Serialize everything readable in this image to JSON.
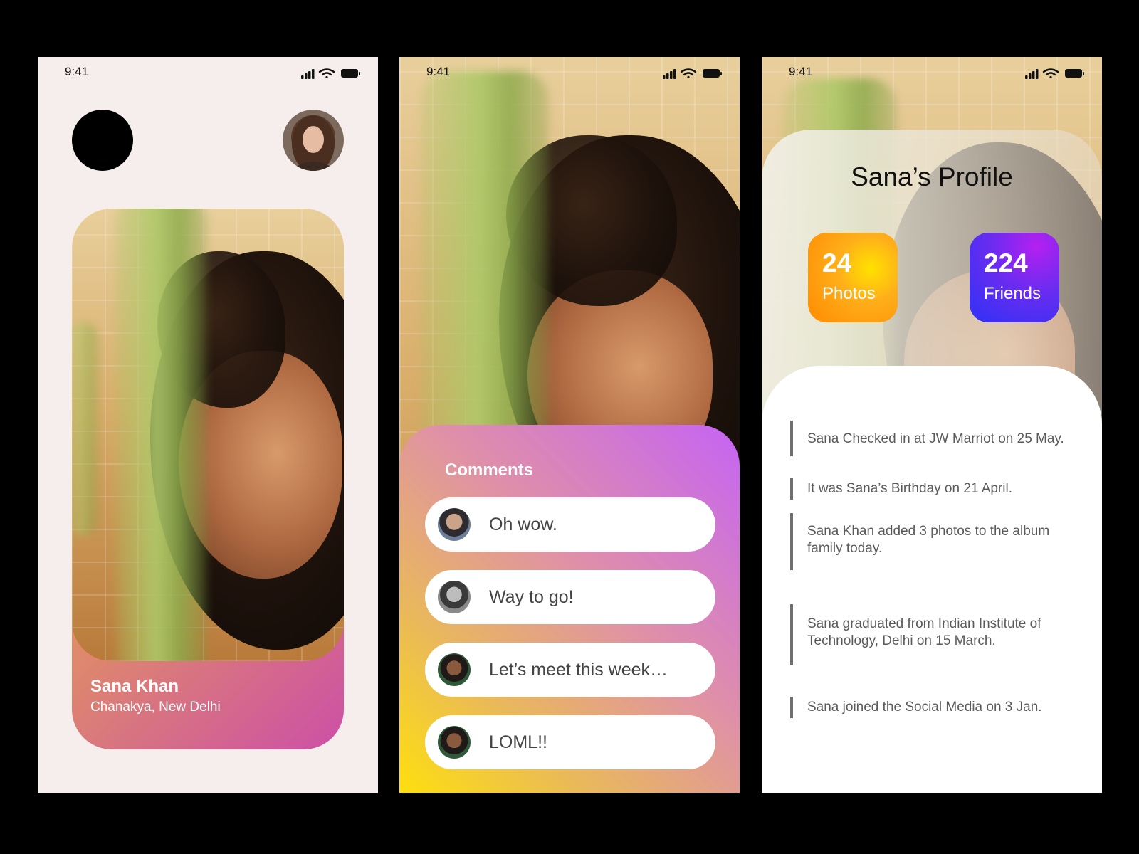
{
  "screen1": {
    "status": {
      "time": "9:41"
    },
    "profile": {
      "name": "Sana Khan",
      "location": "Chanakya, New Delhi"
    }
  },
  "screen2": {
    "status": {
      "time": "9:41"
    },
    "comments": {
      "title": "Comments",
      "items": [
        {
          "text": "Oh wow."
        },
        {
          "text": "Way to go!"
        },
        {
          "text": "Let’s meet this week…"
        },
        {
          "text": "LOML!!"
        }
      ]
    }
  },
  "screen3": {
    "status": {
      "time": "9:41"
    },
    "title": "Sana’s Profile",
    "stats": {
      "photos": {
        "value": "24",
        "label": "Photos"
      },
      "friends": {
        "value": "224",
        "label": "Friends"
      }
    },
    "activity": [
      {
        "text": "Sana Checked in at JW Marriot on 25 May."
      },
      {
        "text": "It was Sana’s Birthday on 21 April."
      },
      {
        "text": "Sana Khan added 3 photos to the album family today."
      },
      {
        "text": "Sana graduated from Indian Institute of Technology, Delhi on 15 March."
      },
      {
        "text": "Sana joined the Social Media on 3 Jan."
      }
    ]
  },
  "colors": {
    "screen1_background": "#f5eeec",
    "card_gradient": [
      "#f0d000",
      "#e9b455",
      "#df8a6b",
      "#cc4fa6"
    ],
    "comments_gradient": [
      "#ffe10a",
      "#e9b85c",
      "#df90a8",
      "#c563f4"
    ],
    "photos_box": "#ff8a00",
    "friends_box": "#2d32f5",
    "activity_text": "#5a5a5a"
  },
  "icons": [
    "signal-icon",
    "wifi-icon",
    "battery-icon"
  ]
}
